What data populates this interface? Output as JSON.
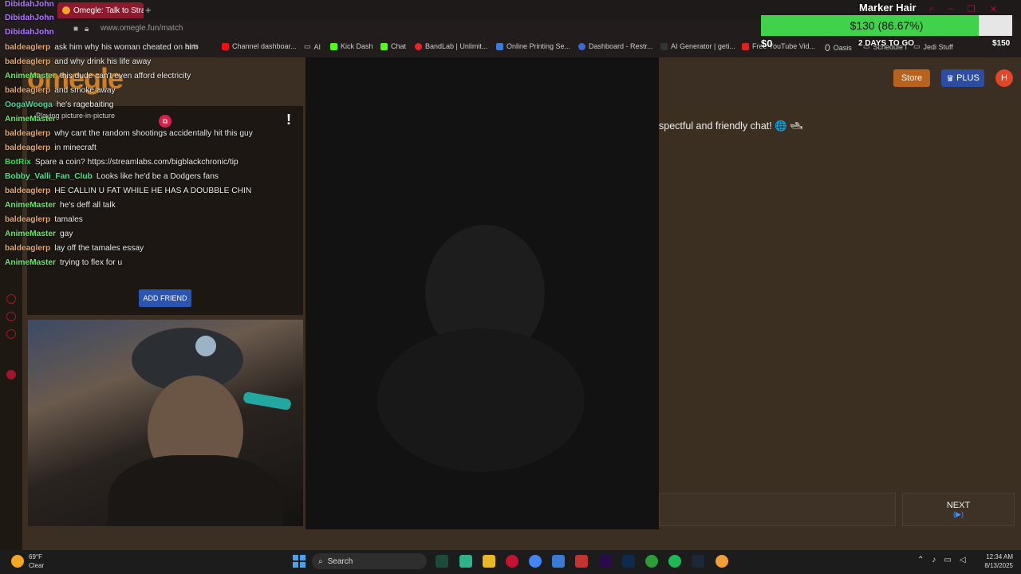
{
  "browser": {
    "tab_title": "Omegle: Talk to Strang",
    "new_tab": "+",
    "url": "www.omegle.fun/match",
    "bookmarks": [
      "Channel dashboar...",
      "AI",
      "Kick Dash",
      "Chat",
      "BandLab | Unlimit...",
      "Online Printing Se...",
      "Dashboard - Restr...",
      "AI Generator | geti...",
      "Free YouTube Vid...",
      "Oasis",
      "Schedule I",
      "Jedi Stuff"
    ],
    "bookmark_partial": "ents"
  },
  "site": {
    "logo": "omegle",
    "store_label": "Store",
    "plus_label": "PLUS",
    "avatar_letter": "H",
    "welcome_text": "spectful and friendly chat! 🌐 🛥",
    "pip_text": "Playing picture-in-picture",
    "add_friend_label": "ADD FRIEND",
    "next_label": "NEXT",
    "next_sub": "(▶)"
  },
  "chat_overlay": [
    {
      "user": "DibidahJohn",
      "color": "#b07bff",
      "msg": ""
    },
    {
      "user": "DibidahJohn",
      "color": "#b07bff",
      "msg": ""
    },
    {
      "user": "DibidahJohn",
      "color": "#b07bff",
      "msg": ""
    },
    {
      "user": "baldeaglerp",
      "color": "#e8a66a",
      "msg": "ask him why his woman cheated on him"
    },
    {
      "user": "baldeaglerp",
      "color": "#e8a66a",
      "msg": "and why drink his life away"
    },
    {
      "user": "AnimeMaster",
      "color": "#6ee36e",
      "msg": "this dude can't even afford electricity"
    },
    {
      "user": "baldeaglerp",
      "color": "#e8a66a",
      "msg": "and smoke away"
    },
    {
      "user": "OogaWooga",
      "color": "#3fd6a0",
      "msg": "he's ragebaiting"
    },
    {
      "user": "AnimeMaster",
      "color": "#6ee36e",
      "msg": ""
    },
    {
      "user": "baldeaglerp",
      "color": "#e8a66a",
      "msg": "why cant the random shootings accidentally hit this guy"
    },
    {
      "user": "baldeaglerp",
      "color": "#e8a66a",
      "msg": "in minecraft"
    },
    {
      "user": "BotRix",
      "color": "#34e05a",
      "msg": "Spare a coin? https://streamlabs.com/bigblackchronic/tip"
    },
    {
      "user": "Bobby_Valli_Fan_Club",
      "color": "#4fe08a",
      "msg": "Looks like he'd be a Dodgers fans"
    },
    {
      "user": "baldeaglerp",
      "color": "#e8a66a",
      "msg": "HE CALLIN U FAT WHILE HE HAS A DOUBBLE CHIN"
    },
    {
      "user": "AnimeMaster",
      "color": "#6ee36e",
      "msg": "he's deff all talk"
    },
    {
      "user": "baldeaglerp",
      "color": "#e8a66a",
      "msg": "tamales"
    },
    {
      "user": "AnimeMaster",
      "color": "#6ee36e",
      "msg": "gay"
    },
    {
      "user": "baldeaglerp",
      "color": "#e8a66a",
      "msg": "lay off the tamales essay"
    },
    {
      "user": "AnimeMaster",
      "color": "#6ee36e",
      "msg": "trying to flex for u"
    }
  ],
  "goal": {
    "title": "Marker Hair",
    "amount_text": "$130 (86.67%)",
    "progress_fraction": 0.8667,
    "min_label": "$0",
    "max_label": "$150",
    "days_left": "2 DAYS TO GO",
    "fill_color": "#3fd24a"
  },
  "taskbar": {
    "temp": "69°F",
    "condition": "Clear",
    "search_label": "Search",
    "time": "12:34 AM",
    "date": "8/13/2025"
  }
}
